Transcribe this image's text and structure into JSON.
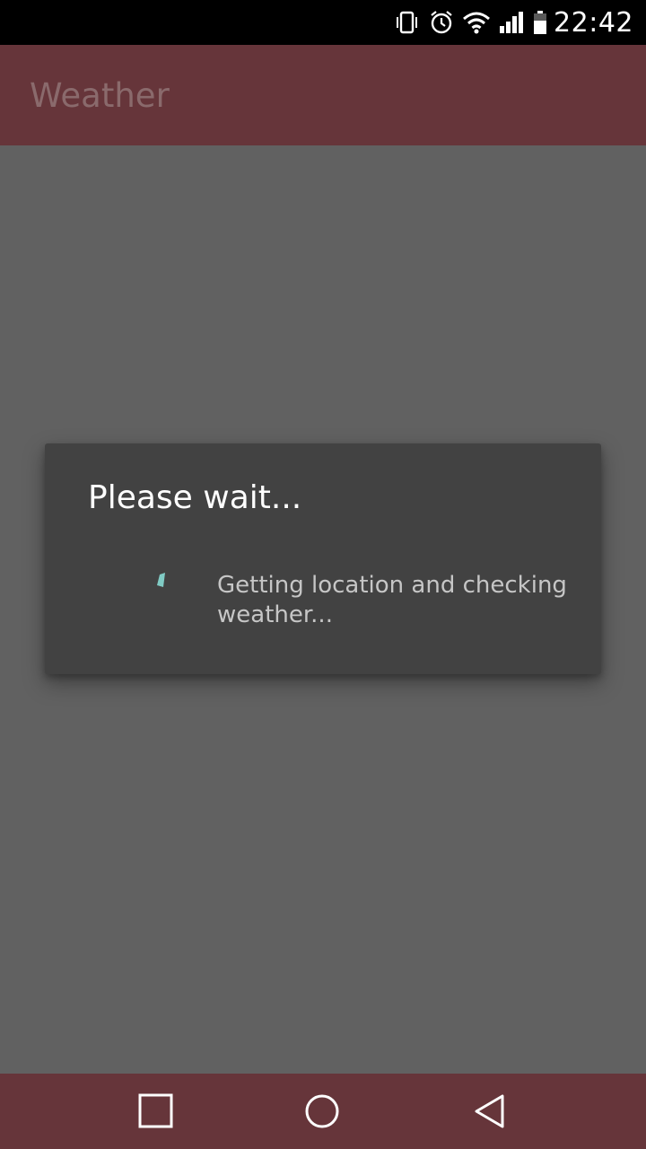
{
  "status_bar": {
    "time": "22:42",
    "icons": [
      "vibrate-icon",
      "alarm-icon",
      "wifi-icon",
      "signal-icon",
      "battery-icon"
    ]
  },
  "app_bar": {
    "title": "Weather"
  },
  "dialog": {
    "title": "Please wait...",
    "message": "Getting location and checking weather...",
    "spinner_color": "#80cbc4"
  },
  "nav_bar": {
    "buttons": [
      "recents-icon",
      "home-icon",
      "back-icon"
    ]
  },
  "colors": {
    "primary_dark": "#66353a",
    "dim_background": "#616161",
    "dialog_background": "#424242"
  }
}
